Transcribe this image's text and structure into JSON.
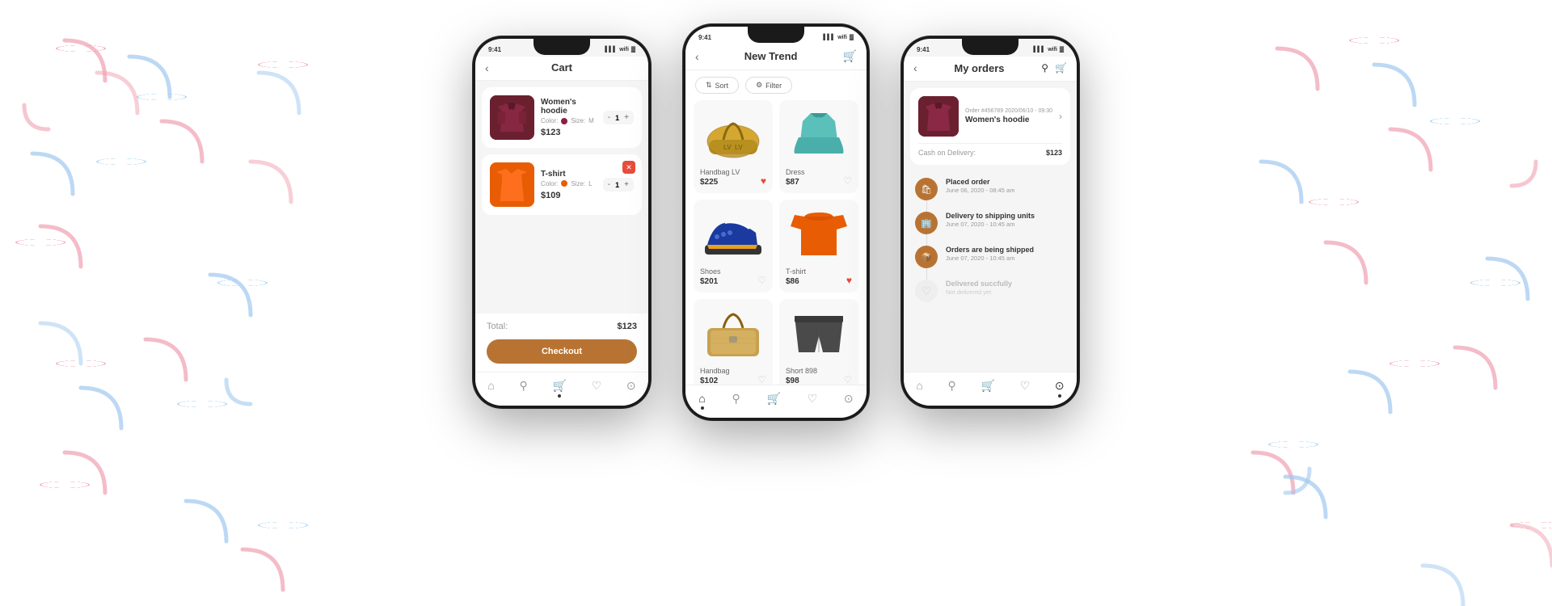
{
  "background": {
    "color": "#ffffff"
  },
  "phone1": {
    "title": "Cart",
    "time": "9:41",
    "items": [
      {
        "name": "Women's hoodie",
        "color_label": "Color:",
        "color": "#8b2040",
        "size_label": "Size:",
        "size": "M",
        "price": "$123",
        "qty": "1"
      },
      {
        "name": "T-shirt",
        "color_label": "Color:",
        "color": "#e85d04",
        "size_label": "Size:",
        "size": "L",
        "price": "$109",
        "qty": "1"
      }
    ],
    "total_label": "Total:",
    "total": "$123",
    "checkout_label": "Checkout"
  },
  "phone2": {
    "title": "New Trend",
    "time": "9:41",
    "filter_label": "Sort",
    "filter2_label": "Filter",
    "products": [
      {
        "name": "Handbag LV",
        "price": "$225",
        "heart": "red"
      },
      {
        "name": "Dress",
        "price": "$87",
        "heart": "gray"
      },
      {
        "name": "Shoes",
        "price": "$201",
        "heart": "gray"
      },
      {
        "name": "T-shirt",
        "price": "$86",
        "heart": "red"
      },
      {
        "name": "Handbag",
        "price": "$102",
        "heart": "gray"
      },
      {
        "name": "Short 898",
        "price": "$98",
        "heart": "gray"
      }
    ]
  },
  "phone3": {
    "title": "My orders",
    "time": "9:41",
    "order": {
      "number": "Order #456789",
      "date": "2020/06/10 - 09:30",
      "product_name": "Women's hoodie",
      "payment_label": "Cash on Delivery:",
      "payment_value": "$123"
    },
    "timeline": [
      {
        "icon": "🛍",
        "title": "Placed order",
        "date": "June 06, 2020 - 08:45 am",
        "active": true
      },
      {
        "icon": "🏢",
        "title": "Delivery to shipping units",
        "date": "June 07, 2020 - 10:45 am",
        "active": true
      },
      {
        "icon": "📦",
        "title": "Orders are being shipped",
        "date": "June 07, 2020 - 10:45 am",
        "active": true
      },
      {
        "icon": "♡",
        "title": "Delivered succfully",
        "date": "Not delivered yet",
        "active": false
      }
    ]
  }
}
